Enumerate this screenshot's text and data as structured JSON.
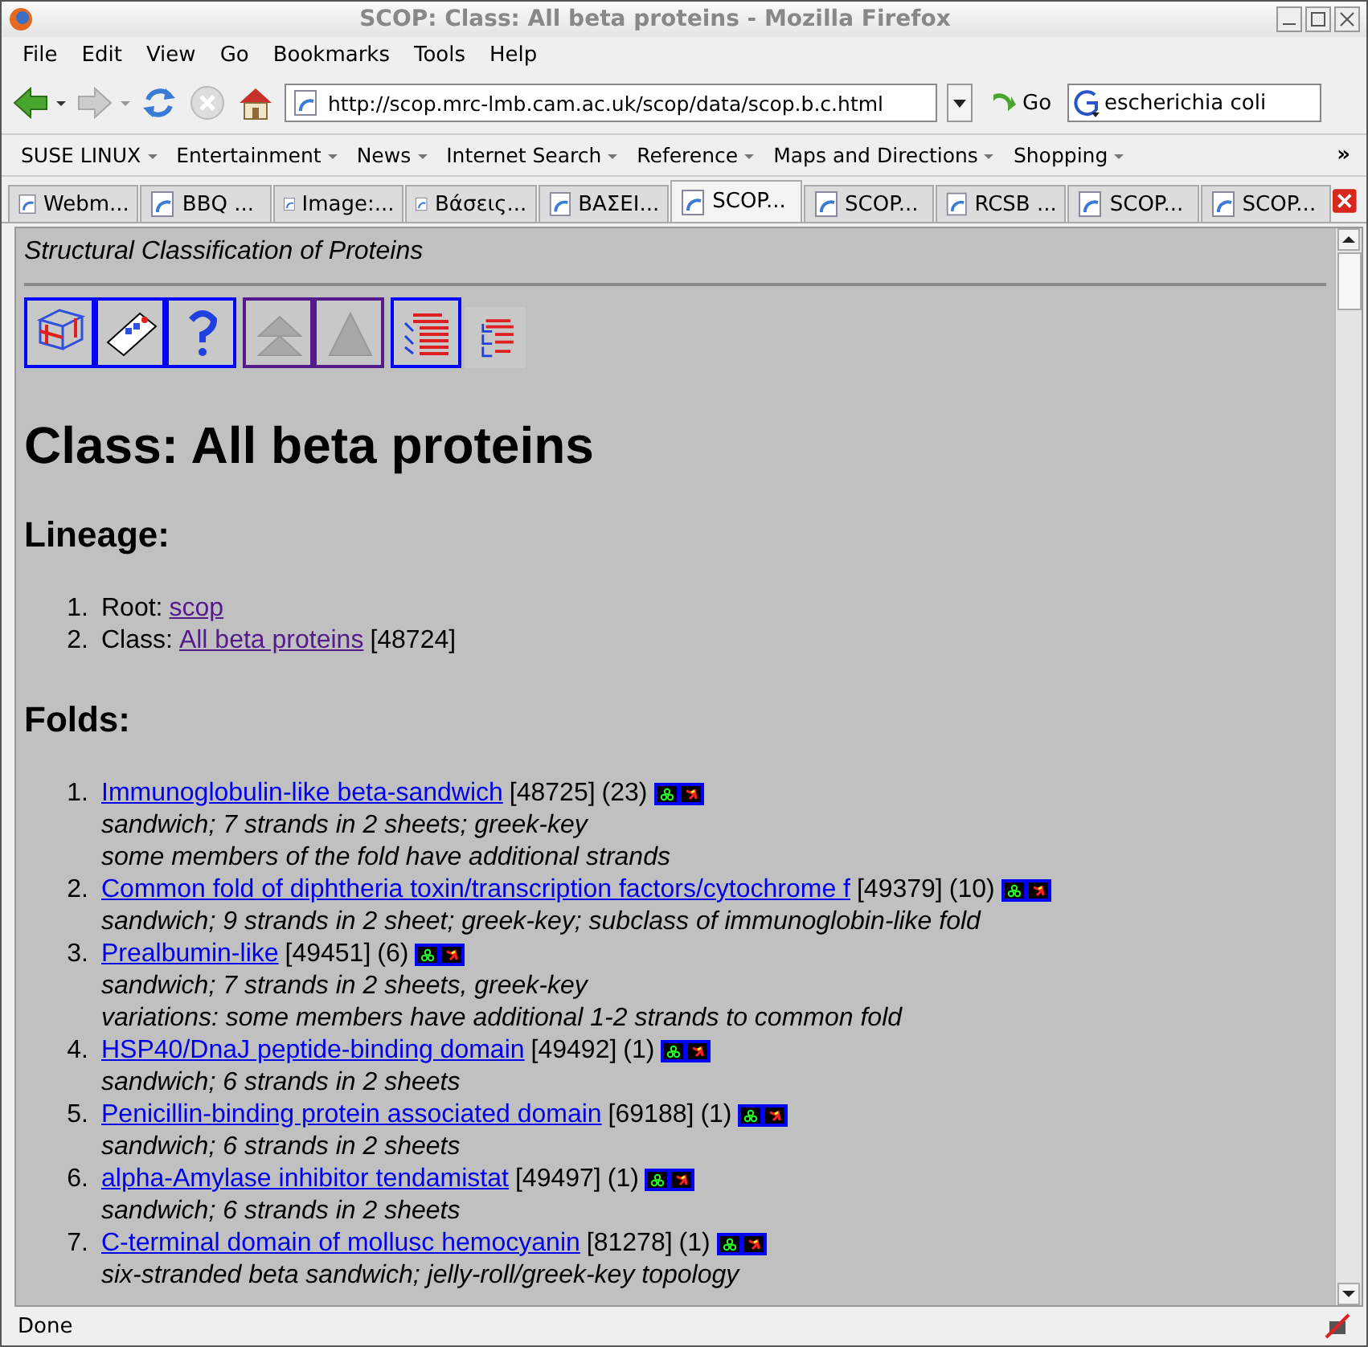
{
  "window": {
    "title": "SCOP: Class: All beta proteins - Mozilla Firefox"
  },
  "menu": [
    "File",
    "Edit",
    "View",
    "Go",
    "Bookmarks",
    "Tools",
    "Help"
  ],
  "navigation": {
    "url": "http://scop.mrc-lmb.cam.ac.uk/scop/data/scop.b.c.html",
    "go_label": "Go",
    "search": {
      "value": "escherichia coli"
    }
  },
  "bookmarks": [
    "SUSE LINUX",
    "Entertainment",
    "News",
    "Internet Search",
    "Reference",
    "Maps and Directions",
    "Shopping"
  ],
  "bookmarks_more": "»",
  "tabs": [
    {
      "label": "Webm...",
      "selected": false
    },
    {
      "label": "BBQ ...",
      "selected": false
    },
    {
      "label": "Image:...",
      "selected": false
    },
    {
      "label": "Βάσεις...",
      "selected": false
    },
    {
      "label": "ΒΑΣΕΙ...",
      "selected": false
    },
    {
      "label": "SCOP...",
      "selected": true
    },
    {
      "label": "SCOP...",
      "selected": false
    },
    {
      "label": "RCSB ...",
      "selected": false
    },
    {
      "label": "SCOP...",
      "selected": false
    },
    {
      "label": "SCOP...",
      "selected": false
    }
  ],
  "page": {
    "subtitle": "Structural Classification of Proteins",
    "nav_buttons": [
      {
        "kind": "unvisited"
      },
      {
        "kind": "unvisited"
      },
      {
        "kind": "unvisited"
      },
      {
        "kind": "visited"
      },
      {
        "kind": "visited"
      },
      {
        "kind": "unvisited"
      },
      {
        "kind": "plain"
      }
    ],
    "heading": "Class: All beta proteins",
    "lineage_heading": "Lineage:",
    "lineage": [
      {
        "number": "1.",
        "label": "Root:",
        "link": "scop",
        "visited": true
      },
      {
        "number": "2.",
        "label": "Class:",
        "link": "All beta proteins",
        "visited": true,
        "sunid": "[48724]"
      }
    ],
    "folds_heading": "Folds:",
    "folds": [
      {
        "number": "1.",
        "name": "Immunoglobulin-like beta-sandwich",
        "visited": false,
        "sunid": "[48725]",
        "count": "(23)",
        "notes": [
          "sandwich; 7 strands in 2 sheets; greek-key",
          "some members of the fold have additional strands"
        ]
      },
      {
        "number": "2.",
        "name": "Common fold of diphtheria toxin/transcription factors/cytochrome f",
        "visited": false,
        "sunid": "[49379]",
        "count": "(10)",
        "notes": [
          "sandwich; 9 strands in 2 sheet; greek-key; subclass of immunoglobin-like fold"
        ]
      },
      {
        "number": "3.",
        "name": "Prealbumin-like",
        "visited": false,
        "sunid": "[49451]",
        "count": "(6)",
        "notes": [
          "sandwich; 7 strands in 2 sheets, greek-key",
          "variations: some members have additional 1-2 strands to common fold"
        ]
      },
      {
        "number": "4.",
        "name": "HSP40/DnaJ peptide-binding domain",
        "visited": false,
        "sunid": "[49492]",
        "count": "(1)",
        "notes": [
          "sandwich; 6 strands in 2 sheets"
        ]
      },
      {
        "number": "5.",
        "name": "Penicillin-binding protein associated domain",
        "visited": false,
        "sunid": "[69188]",
        "count": "(1)",
        "notes": [
          "sandwich; 6 strands in 2 sheets"
        ]
      },
      {
        "number": "6.",
        "name": "alpha-Amylase inhibitor tendamistat",
        "visited": false,
        "sunid": "[49497]",
        "count": "(1)",
        "notes": [
          "sandwich; 6 strands in 2 sheets"
        ]
      },
      {
        "number": "7.",
        "name": "C-terminal domain of mollusc hemocyanin",
        "visited": false,
        "sunid": "[81278]",
        "count": "(1)",
        "notes": [
          "six-stranded beta sandwich; jelly-roll/greek-key topology"
        ]
      }
    ]
  },
  "status_bar": {
    "text": "Done"
  }
}
